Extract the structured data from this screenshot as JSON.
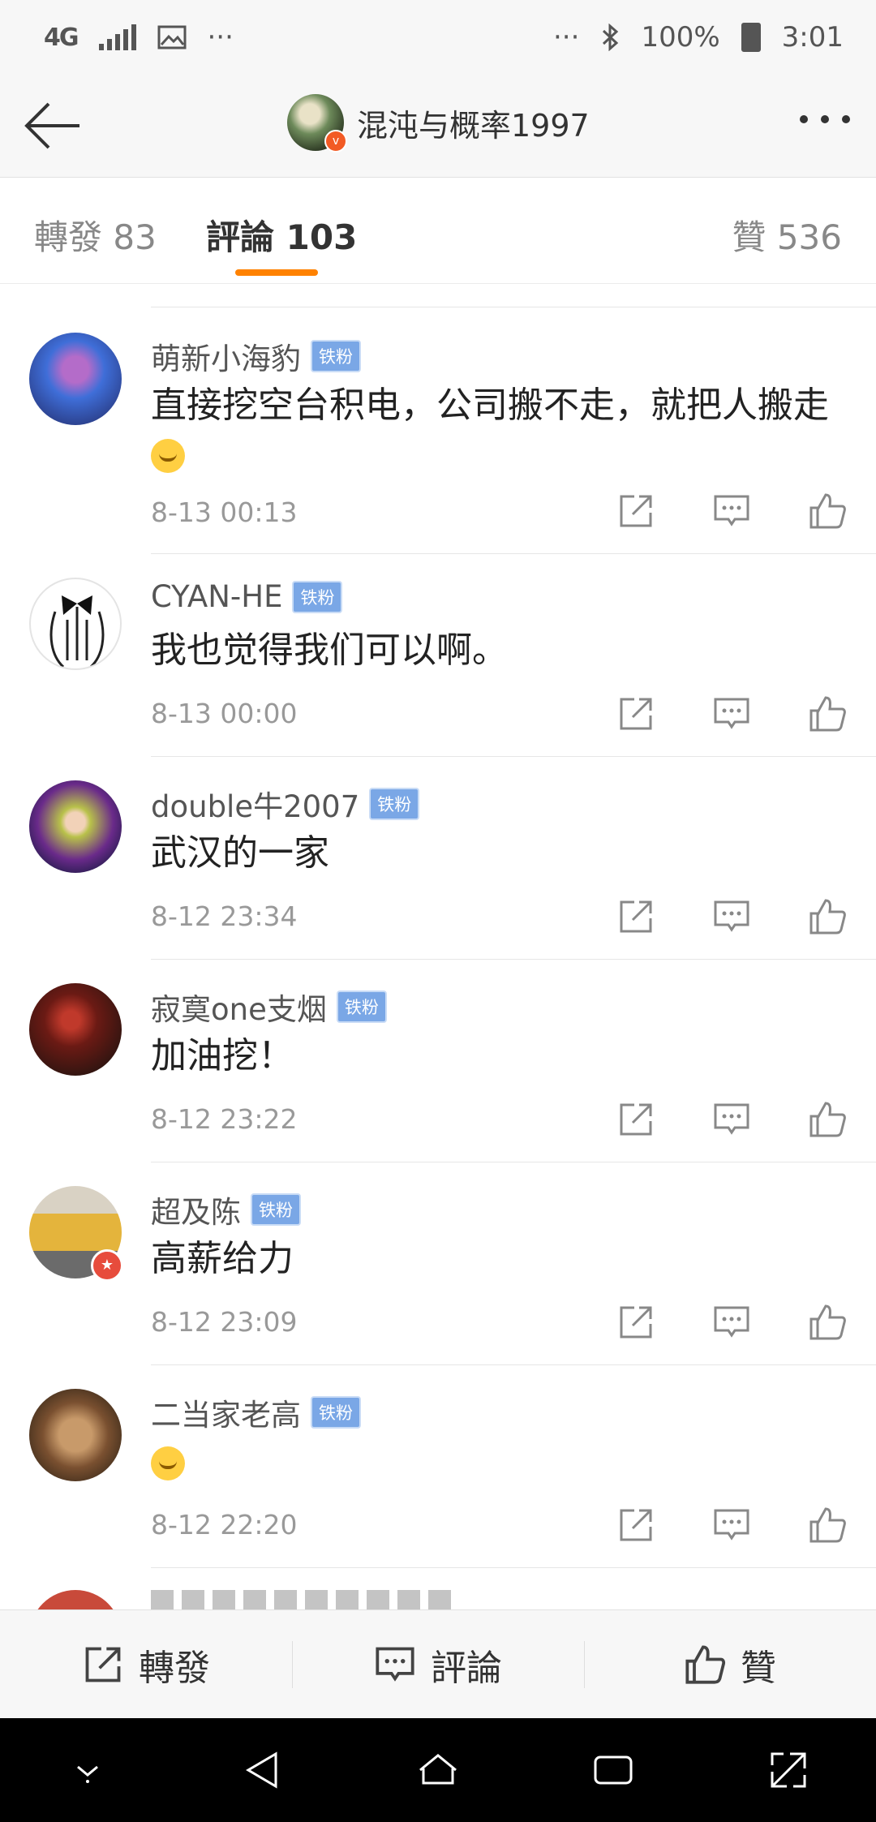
{
  "status_bar": {
    "network": "4G",
    "battery": "100%",
    "time": "3:01"
  },
  "header": {
    "username": "混沌与概率1997"
  },
  "tabs": [
    {
      "label": "轉發 83"
    },
    {
      "label": "評論 103"
    },
    {
      "label": "贊 536"
    }
  ],
  "badge_label": "铁粉",
  "comments": [
    {
      "name": "萌新小海豹",
      "text": "直接挖空台积电，公司搬不走，就把人搬走",
      "time": "8-13 00:13"
    },
    {
      "name": "CYAN-HE",
      "text": "我也觉得我们可以啊。",
      "time": "8-13 00:00"
    },
    {
      "name": "double牛2007",
      "text": "武汉的一家",
      "time": "8-12 23:34"
    },
    {
      "name": "寂寞one支烟",
      "text": "加油挖！",
      "time": "8-12 23:22"
    },
    {
      "name": "超及陈",
      "text": "高薪给力",
      "time": "8-12 23:09"
    },
    {
      "name": "二当家老高",
      "text": "",
      "time": "8-12 22:20"
    }
  ],
  "bottom_bar": {
    "repost": "轉發",
    "comment": "評論",
    "like": "贊"
  },
  "colors": {
    "accent": "#ff8200",
    "badge": "#7aa7e6"
  }
}
